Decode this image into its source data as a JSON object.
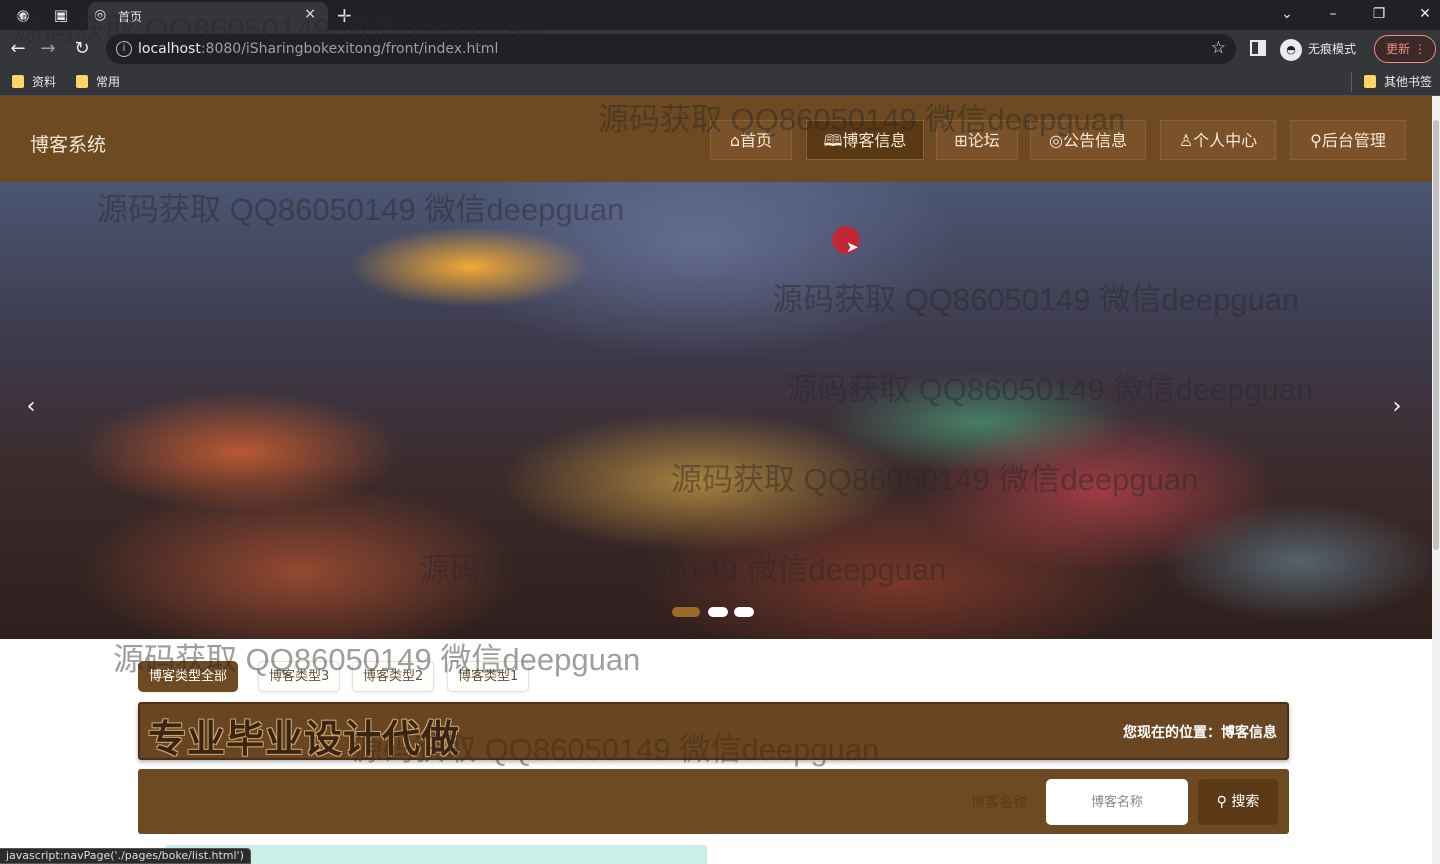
{
  "browser": {
    "tab_title": "首页",
    "tab_close": "×",
    "new_tab": "+",
    "url_host": "localhost",
    "url_rest": ":8080/iSharingbokexitong/front/index.html",
    "incognito_label": "无痕模式",
    "update_label": "更新",
    "bookmarks": [
      "资料",
      "常用"
    ],
    "other_bookmarks": "其他书签",
    "status_text": "javascript:navPage('./pages/boke/list.html')"
  },
  "site": {
    "title": "博客系统",
    "nav": [
      {
        "icon": "home-icon",
        "label": "⌂首页"
      },
      {
        "icon": "book-icon",
        "label": "🕮博客信息"
      },
      {
        "icon": "forum-icon",
        "label": "⊞论坛"
      },
      {
        "icon": "notice-icon",
        "label": "◎公告信息"
      },
      {
        "icon": "user-icon",
        "label": "♙个人中心"
      },
      {
        "icon": "link-icon",
        "label": "⚲后台管理"
      }
    ],
    "active_nav": "博客信息"
  },
  "banner": {
    "prev": "‹",
    "next": "›",
    "slide_count": 3,
    "active_slide": 1
  },
  "categories": [
    "博客类型全部",
    "博客类型3",
    "博客类型2",
    "博客类型1"
  ],
  "breadcrumb": {
    "promo_text": "专业毕业设计代做",
    "location_text": "您现在的位置：博客信息"
  },
  "search": {
    "label": "博客名称",
    "placeholder": "博客名称",
    "value": "",
    "button_label": "搜索",
    "button_icon": "search-icon"
  },
  "watermark": "源码获取 QQ86050149 微信deepguan",
  "colors": {
    "header_bg": "#6e4a22",
    "active_tab": "#6e4a22",
    "browser_dark": "#202124",
    "update_red": "#f28b82"
  }
}
